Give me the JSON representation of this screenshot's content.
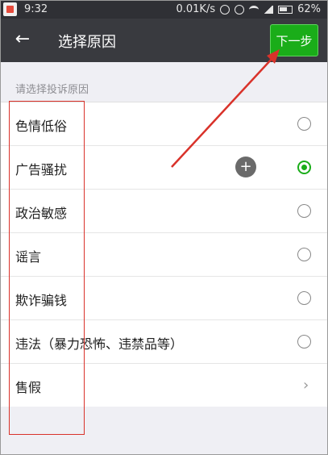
{
  "status_bar": {
    "time": "9:32",
    "speed": "0.01K/s",
    "battery": "62%"
  },
  "appbar": {
    "back_icon": "arrow-left-icon",
    "title": "选择原因",
    "next_label": "下一步",
    "accent": "#1aad19"
  },
  "section_label": "请选择投诉原因",
  "reasons": [
    {
      "label": "色情低俗",
      "control": "radio",
      "checked": false
    },
    {
      "label": "广告骚扰",
      "control": "radio",
      "checked": true
    },
    {
      "label": "政治敏感",
      "control": "radio",
      "checked": false
    },
    {
      "label": "谣言",
      "control": "radio",
      "checked": false
    },
    {
      "label": "欺诈骗钱",
      "control": "radio",
      "checked": false
    },
    {
      "label": "违法（暴力恐怖、违禁品等）",
      "control": "radio",
      "checked": false
    },
    {
      "label": "售假",
      "control": "chevron",
      "chevron": "›"
    }
  ],
  "floating_button": {
    "icon": "plus-icon",
    "glyph": "+"
  }
}
